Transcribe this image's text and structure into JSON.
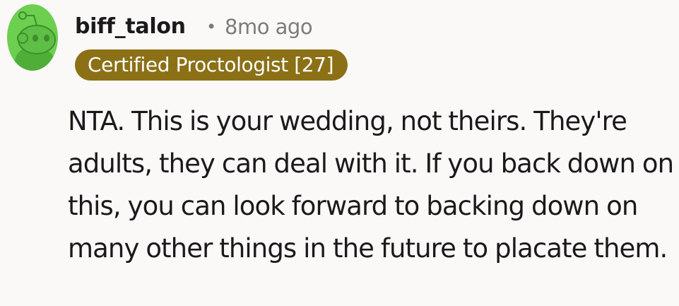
{
  "comment": {
    "author": "biff_talon",
    "separator": "•",
    "timestamp": "8mo ago",
    "flair": "Certified Proctologist [27]",
    "body": "NTA. This is your wedding, not theirs. They're adults, they can deal with it. If you back down on this, you can look forward to backing down on many other things in the future to placate them.",
    "avatar_icon": "snoo-avatar-icon"
  },
  "colors": {
    "background": "#faf9f8",
    "avatar_green": "#6dcf4f",
    "flair_bg": "#8b7016",
    "flair_text": "#ffffff",
    "meta_gray": "#7c7c7c"
  }
}
